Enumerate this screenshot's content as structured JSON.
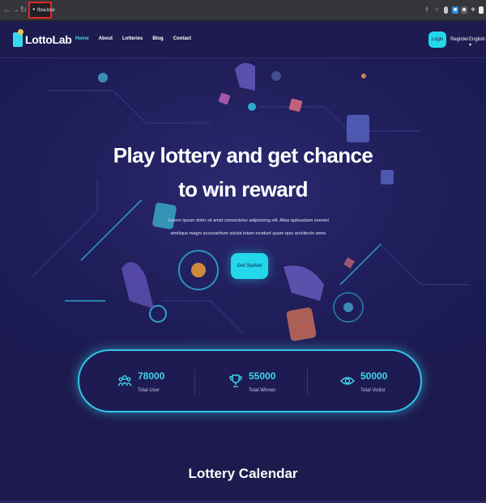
{
  "browser": {
    "url": "flow.box",
    "icons": [
      "back-icon",
      "forward-icon",
      "reload-icon",
      "lock-icon",
      "share-icon",
      "star-icon",
      "extension-icon",
      "puzzle-icon",
      "menu-icon"
    ]
  },
  "header": {
    "logo": "LottoLab",
    "nav": [
      {
        "label": "Home",
        "active": true
      },
      {
        "label": "About",
        "active": false
      },
      {
        "label": "Lotteries",
        "active": false
      },
      {
        "label": "Blog",
        "active": false
      },
      {
        "label": "Contact",
        "active": false
      }
    ],
    "login": "Login",
    "register": "Register",
    "language": "English"
  },
  "hero": {
    "title_line1": "Play lottery and get chance",
    "title_line2": "to win reward",
    "text_line1": "Lorem ipsum dolor sit amet consectetur adipisicing elit. Alias quibusdam eveniet",
    "text_line2": "similique magni accusantium soluta totam incidunt quam quis architecto amet.",
    "cta": "Get Started"
  },
  "stats": [
    {
      "value": "78000",
      "label": "Total User",
      "icon": "users-icon"
    },
    {
      "value": "55000",
      "label": "Total Winner",
      "icon": "trophy-icon"
    },
    {
      "value": "50000",
      "label": "Total Visitor",
      "icon": "eye-icon"
    }
  ],
  "section": {
    "title": "Lottery Calendar"
  },
  "colors": {
    "accent": "#24d8ec",
    "background": "#1d1a4d"
  }
}
